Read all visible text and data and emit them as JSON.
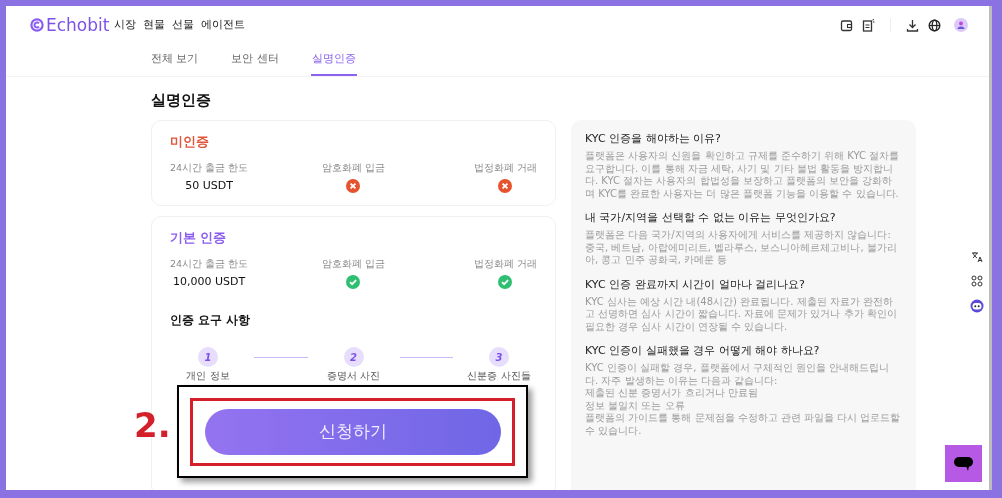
{
  "header": {
    "logo": "Echobit",
    "nav": [
      "시장",
      "현물",
      "선물",
      "에이전트"
    ]
  },
  "tabs": [
    {
      "label": "전체 보기",
      "selected": false
    },
    {
      "label": "보안 센터",
      "selected": false
    },
    {
      "label": "실명인증",
      "selected": true
    }
  ],
  "page_title": "실명인증",
  "levels": [
    {
      "title": "미인증",
      "kind": "unverified",
      "limits": [
        {
          "label": "24시간 출금 한도",
          "kind": "text",
          "value": "50 USDT"
        },
        {
          "label": "암호화폐 입금",
          "kind": "denied"
        },
        {
          "label": "법정화폐 거래",
          "kind": "denied"
        }
      ]
    },
    {
      "title": "기본 인증",
      "kind": "basic",
      "limits": [
        {
          "label": "24시간 출금 한도",
          "kind": "text",
          "value": "10,000 USDT"
        },
        {
          "label": "암호화폐 입금",
          "kind": "allowed"
        },
        {
          "label": "법정화폐 거래",
          "kind": "allowed"
        }
      ]
    }
  ],
  "requirements": {
    "title": "인증 요구 사항",
    "steps": [
      {
        "number": "1",
        "label": "개인 정보"
      },
      {
        "number": "2",
        "label": "증명서 사진"
      },
      {
        "number": "3",
        "label": "신분증 사진들"
      }
    ]
  },
  "faq": [
    {
      "question": "KYC 인증을 해야하는 이유?",
      "answer": [
        "플랫폼은 사용자의 신원을 확인하고 규제를 준수하기 위해 KYC 절차를 요구합니다. 이를 통해 자금 세탁, 사기 및 기타 불법 활동을 방지합니다. KYC 절차는 사용자의 합법성을 보장하고 플랫폼의 보안을 강화하며 KYC를 완료한 사용자는 더 많은 플랫폼 기능을 이용할 수 있습니다."
      ]
    },
    {
      "question": "내 국가/지역을 선택할 수 없는 이유는 무엇인가요?",
      "answer": [
        "플랫폼은 다음 국가/지역의 사용자에게 서비스를 제공하지 않습니다: 중국, 베트남, 아랍에미리트, 벨라루스, 보스니아헤르체고비나, 불가리아, 콩고 민주 공화국, 카메룬 등"
      ]
    },
    {
      "question": "KYC 인증 완료까지 시간이 얼마나 걸리나요?",
      "answer": [
        "KYC 심사는 예상 시간 내(48시간) 완료됩니다. 제출된 자료가 완전하고 선명하면 심사 시간이 짧습니다. 자료에 문제가 있거나 추가 확인이 필요한 경우 심사 시간이 연장될 수 있습니다."
      ]
    },
    {
      "question": "KYC 인증이 실패했을 경우 어떻게 해야 하나요?",
      "answer": [
        "KYC 인증이 실패할 경우, 플랫폼에서 구체적인 원인을 안내해드립니다. 자주 발생하는 이유는 다음과 같습니다:",
        "제출된 신분 증명서가 흐리거나 만료됨",
        "정보 불일치 또는 오류",
        "플랫폼의 가이드를 통해 문제점을 수정하고 관련 파일을 다시 업로드할 수 있습니다."
      ]
    }
  ],
  "annotation": {
    "step_label": "2.",
    "button": "신청하기"
  }
}
